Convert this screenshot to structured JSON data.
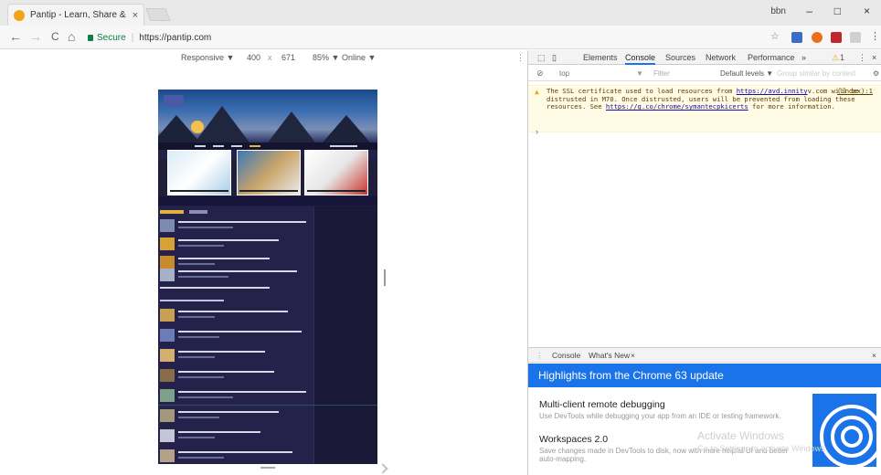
{
  "browser": {
    "tab_title": "Pantip - Learn, Share & !",
    "tab_close": "×",
    "user_badge": "bbn",
    "window_controls": [
      "–",
      "□",
      "×"
    ],
    "nav": {
      "back": "←",
      "forward": "→",
      "reload": "C",
      "home": "⌂"
    },
    "secure_label": "Secure",
    "url": "https://pantip.com"
  },
  "device_toolbar": {
    "mode": "Responsive ▼",
    "width": "400",
    "times": "x",
    "height": "671",
    "zoom": "85% ▼",
    "network": "Online ▼"
  },
  "devtools": {
    "tabs": [
      "Elements",
      "Console",
      "Sources",
      "Network",
      "Performance"
    ],
    "more": "»",
    "warning_count": "1",
    "active_tab": "Console",
    "filter": {
      "context": "top",
      "filter_placeholder": "Filter",
      "levels": "Default levels ▼",
      "hide_network": "Group similar by context"
    },
    "warning": {
      "text_1": "The SSL certificate used to load resources from ",
      "link_1": "https://avd.innity",
      "text_2": "v.com will be distrusted in M70. Once distrusted, users will be prevented from loading these resources. See ",
      "link_2": "https://g.co/chrome/symantecpkicerts",
      "text_3": " for more information.",
      "source": "(index):1"
    },
    "prompt": "›",
    "drawer": {
      "tabs": [
        "Console",
        "What's New"
      ],
      "tab_close": "×",
      "close": "×",
      "highlights_title": "Highlights from the Chrome 63 update",
      "features": [
        {
          "title": "Multi-client remote debugging",
          "desc": "Use DevTools while debugging your app from an IDE or testing framework."
        },
        {
          "title": "Workspaces 2.0",
          "desc": "Save changes made in DevTools to disk, now with more helpful UI and better auto-mapping."
        }
      ],
      "watermark_line1": "Activate Windows",
      "watermark_line2": "Go to Settings to activate Windows."
    }
  },
  "colors": {
    "accent": "#1a73e8",
    "secure": "#0b8043",
    "warning_bg": "#fffbe5",
    "site_bg": "#24224a"
  }
}
